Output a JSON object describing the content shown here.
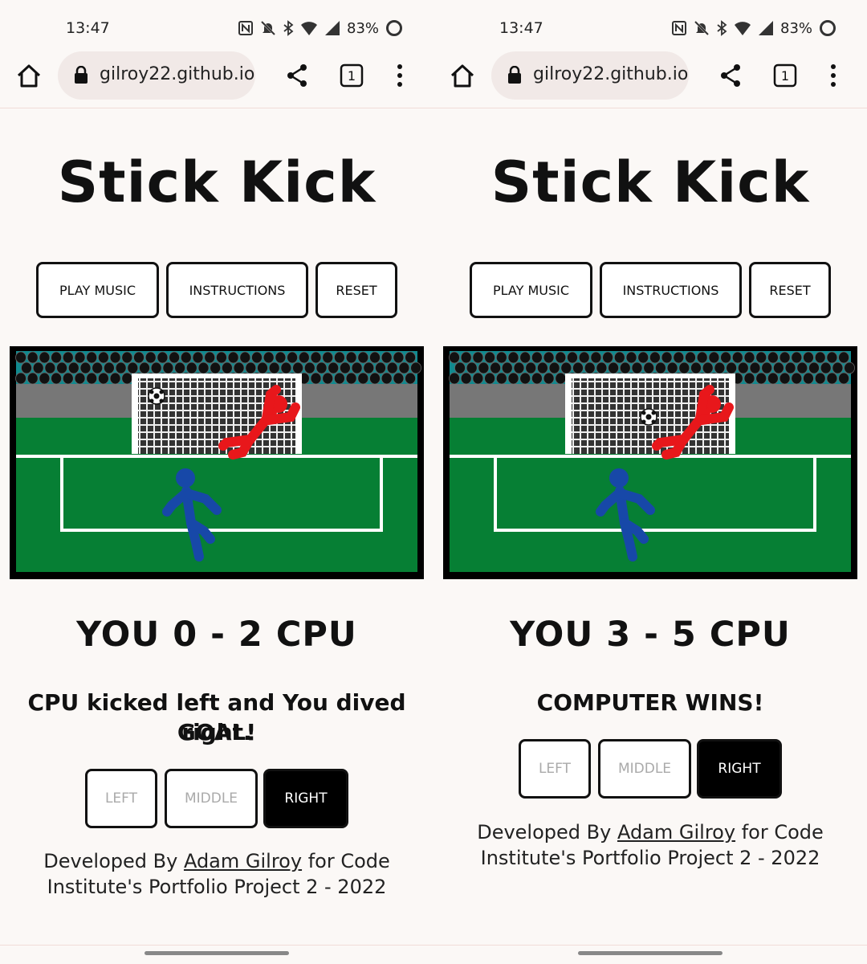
{
  "colors": {
    "pitch_green": "#067f34",
    "crowd_teal": "#118a8f",
    "stand_grey": "#777777",
    "keeper_red": "#e8171b",
    "player_blue": "#1748a8",
    "active_button": "#000000"
  },
  "panels": [
    {
      "status": {
        "time": "13:47",
        "battery": "83%"
      },
      "browser": {
        "url": "gilroy22.github.io",
        "tab_count": "1"
      },
      "title": "Stick Kick",
      "buttons": {
        "play_music": "PLAY MUSIC",
        "instructions": "INSTRUCTIONS",
        "reset": "RESET"
      },
      "score": "YOU 0 - 2 CPU",
      "message": "CPU kicked left and You dived right.",
      "message_line2": "GOAL!",
      "directions": {
        "left": "LEFT",
        "middle": "MIDDLE",
        "right": "RIGHT",
        "selected": "right"
      },
      "ball_position": "top-left",
      "footer": {
        "prefix": "Developed By ",
        "author": "Adam Gilroy",
        "suffix_line1": " for Code",
        "line2": "Institute's Portfolio Project 2 - 2022"
      }
    },
    {
      "status": {
        "time": "13:47",
        "battery": "83%"
      },
      "browser": {
        "url": "gilroy22.github.io",
        "tab_count": "1"
      },
      "title": "Stick Kick",
      "buttons": {
        "play_music": "PLAY MUSIC",
        "instructions": "INSTRUCTIONS",
        "reset": "RESET"
      },
      "score": "YOU 3 - 5 CPU",
      "message": "COMPUTER WINS!",
      "message_line2": "",
      "directions": {
        "left": "LEFT",
        "middle": "MIDDLE",
        "right": "RIGHT",
        "selected": "right"
      },
      "ball_position": "middle",
      "footer": {
        "prefix": "Developed By ",
        "author": "Adam Gilroy",
        "suffix_line1": " for Code",
        "line2": "Institute's Portfolio Project 2 - 2022"
      }
    }
  ]
}
